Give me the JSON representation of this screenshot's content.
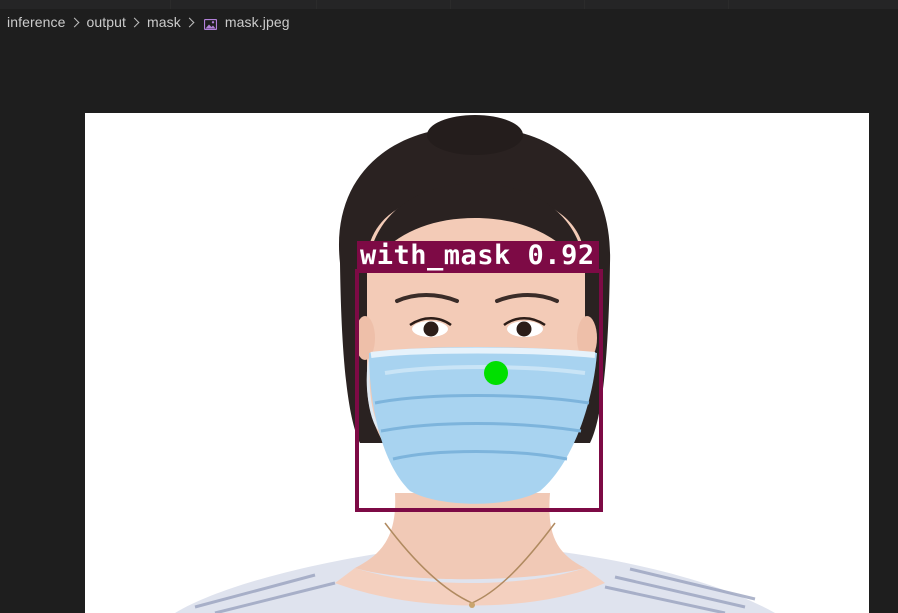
{
  "breadcrumb": {
    "items": [
      "inference",
      "output",
      "mask"
    ],
    "file": "mask.jpeg",
    "file_icon": "image-file-icon"
  },
  "detection": {
    "label": "with_mask 0.92",
    "box_color": "#7d0a45",
    "point_color": "#00e000"
  },
  "colors": {
    "background": "#1e1e1e",
    "image_background": "#ffffff",
    "breadcrumb_text": "#cccccc"
  }
}
